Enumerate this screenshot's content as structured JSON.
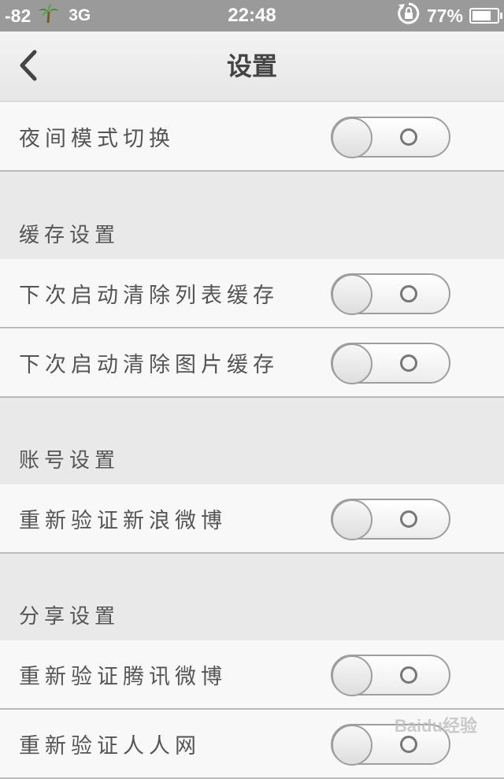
{
  "status_bar": {
    "signal": "-82",
    "network": "3G",
    "time": "22:48",
    "battery": "77%",
    "battery_level": 0.77
  },
  "nav": {
    "title": "设置",
    "back_icon": "chevron-left-icon"
  },
  "rows": [
    {
      "label": "夜间模式切换",
      "on": false
    },
    {
      "section": "缓存设置"
    },
    {
      "label": "下次启动清除列表缓存",
      "on": false
    },
    {
      "label": "下次启动清除图片缓存",
      "on": false
    },
    {
      "section": "账号设置"
    },
    {
      "label": "重新验证新浪微博",
      "on": false
    },
    {
      "section": "分享设置"
    },
    {
      "label": "重新验证腾讯微博",
      "on": false
    },
    {
      "label": "重新验证人人网",
      "on": false
    }
  ],
  "watermark": "Baidu经验"
}
